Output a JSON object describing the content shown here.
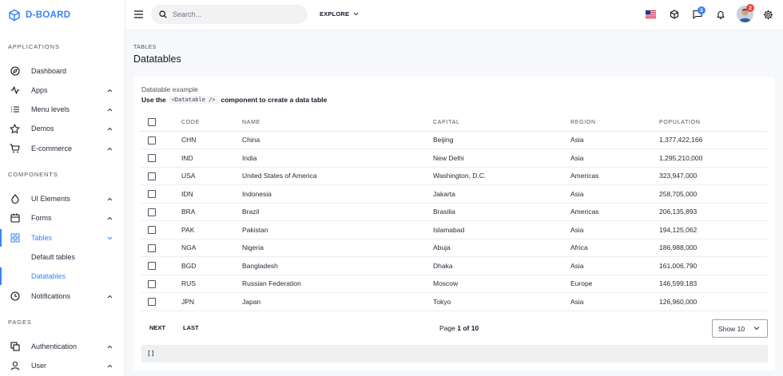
{
  "brand": {
    "name": "D-BOARD",
    "color": "#3b82f6"
  },
  "sidebar": {
    "sections": [
      "APPLICATIONS",
      "COMPONENTS",
      "PAGES"
    ],
    "items": [
      {
        "label": "Dashboard",
        "icon": "compass-icon"
      },
      {
        "label": "Apps",
        "icon": "activity-icon"
      },
      {
        "label": "Menu levels",
        "icon": "list-icon"
      },
      {
        "label": "Demos",
        "icon": "star-icon"
      },
      {
        "label": "E-commerce",
        "icon": "cart-icon"
      },
      {
        "label": "UI Elements",
        "icon": "droplet-icon"
      },
      {
        "label": "Forms",
        "icon": "calendar-icon"
      },
      {
        "label": "Tables",
        "icon": "grid-icon"
      },
      {
        "label": "Notifications",
        "icon": "clock-icon"
      },
      {
        "label": "Authentication",
        "icon": "copy-icon"
      },
      {
        "label": "User",
        "icon": "user-icon"
      }
    ],
    "sub_items": [
      "Default tables",
      "Datatables"
    ]
  },
  "topbar": {
    "search_placeholder": "Search...",
    "explore_label": "EXPLORE",
    "messages_badge": "5",
    "avatar_badge": "2"
  },
  "page": {
    "breadcrumb": "TABLES",
    "title": "Datatables"
  },
  "card": {
    "subtitle": "Datatable example",
    "desc_before": "Use the",
    "desc_code": "<Datatable />",
    "desc_after": "component to create a data table"
  },
  "table": {
    "headers": [
      "CODE",
      "NAME",
      "CAPITAL",
      "REGION",
      "POPULATION"
    ],
    "rows": [
      [
        "CHN",
        "China",
        "Beijing",
        "Asia",
        "1,377,422,166"
      ],
      [
        "IND",
        "India",
        "New Delhi",
        "Asia",
        "1,295,210,000"
      ],
      [
        "USA",
        "United States of America",
        "Washington, D.C.",
        "Americas",
        "323,947,000"
      ],
      [
        "IDN",
        "Indonesia",
        "Jakarta",
        "Asia",
        "258,705,000"
      ],
      [
        "BRA",
        "Brazil",
        "Brasilia",
        "Americas",
        "206,135,893"
      ],
      [
        "PAK",
        "Pakistan",
        "Islamabad",
        "Asia",
        "194,125,062"
      ],
      [
        "NGA",
        "Nigeria",
        "Abuja",
        "Africa",
        "186,988,000"
      ],
      [
        "BGD",
        "Bangladesh",
        "Dhaka",
        "Asia",
        "161,006,790"
      ],
      [
        "RUS",
        "Russian Federation",
        "Moscow",
        "Europe",
        "146,599,183"
      ],
      [
        "JPN",
        "Japan",
        "Tokyo",
        "Asia",
        "126,960,000"
      ]
    ]
  },
  "pagination": {
    "next_label": "NEXT",
    "last_label": "LAST",
    "page_prefix": "Page",
    "page_current": "1",
    "page_of": "of",
    "page_total": "10",
    "show_label": "Show 10"
  },
  "selection_json": "[]",
  "colors": {
    "accent": "#3b82f6",
    "badge_blue": "#3b82f6",
    "badge_red": "#ef4444"
  }
}
